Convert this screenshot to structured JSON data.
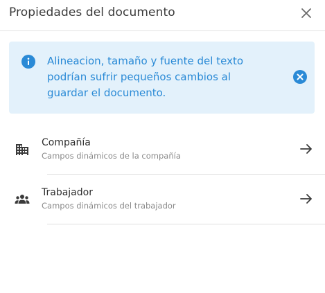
{
  "dialog": {
    "title": "Propiedades del documento"
  },
  "alert": {
    "message": "Alineacion, tamaño y fuente del texto podrían sufrir pequeños cambios al guardar el documento.",
    "color": "#2a8ad6",
    "background": "#e3f1fb"
  },
  "items": [
    {
      "label": "Compañía",
      "description": "Campos dinámicos de la compañía",
      "icon": "building-icon"
    },
    {
      "label": "Trabajador",
      "description": "Campos dinámicos del trabajador",
      "icon": "people-icon"
    }
  ]
}
